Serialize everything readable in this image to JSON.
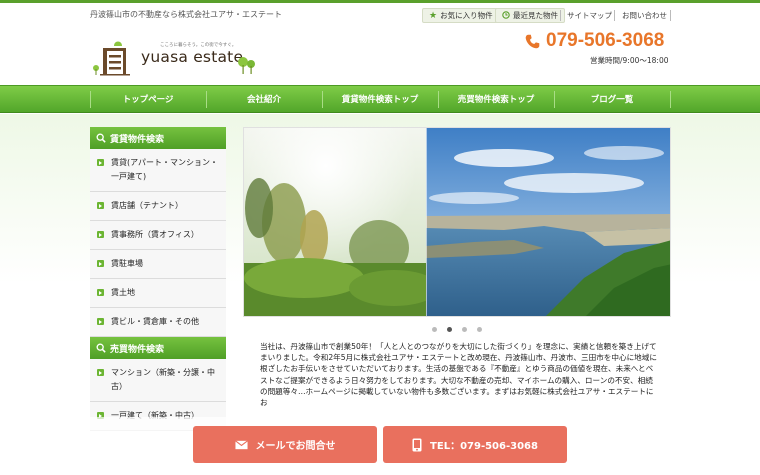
{
  "header": {
    "tagline": "丹波篠山市の不動産なら株式会社ユアサ・エステート",
    "util_links": {
      "favorites": "お気に入り物件",
      "recent": "最近見た物件",
      "sitemap": "サイトマップ",
      "contact": "お問い合わせ"
    },
    "logo": {
      "name": "yuasa estate",
      "subtitle": "こころに暮らそう。この街で今すぐ。"
    },
    "phone": "079-506-3068",
    "hours": "営業時間/9:00〜18:00"
  },
  "nav": {
    "items": [
      "トップページ",
      "会社紹介",
      "賃貸物件検索トップ",
      "売買物件検索トップ",
      "ブログ一覧"
    ]
  },
  "sidebar": {
    "rental_heading": "賃貸物件検索",
    "rental_items": [
      "賃貸(アパート・マンション・一戸建て)",
      "賃店舗（テナント）",
      "賃事務所（賃オフィス）",
      "賃駐車場",
      "賃土地",
      "賃ビル・賃倉庫・その他"
    ],
    "sale_heading": "売買物件検索",
    "sale_items": [
      "マンション（新築・分譲・中古）",
      "一戸建て（新築・中古）"
    ]
  },
  "intro": {
    "text": "当社は、丹波篠山市で創業50年！「人と人とのつながりを大切にした街づくり」を理念に、実績と信頼を築き上げてまいりました。令和2年5月に株式会社ユアサ・エステートと改め現在、丹波篠山市、丹波市、三田市を中心に地域に根ざしたお手伝いをさせていただいております。生活の基盤である『不動産』とゆう商品の価値を現在、未来へとベストなご提案ができるよう日々努力をしております。大切な不動産の売却、マイホームの購入、ローンの不安、相続の問題等々…ホームページに掲載していない物件も多数ございます。まずはお気軽に株式会社ユアサ・エステートにお"
  },
  "cta": {
    "mail": "メールでお問合せ",
    "tel": "TEL：079-506-3068"
  },
  "colors": {
    "brand_green": "#5aa02c",
    "phone_orange": "#e8762a",
    "cta_coral": "#e9705e"
  }
}
